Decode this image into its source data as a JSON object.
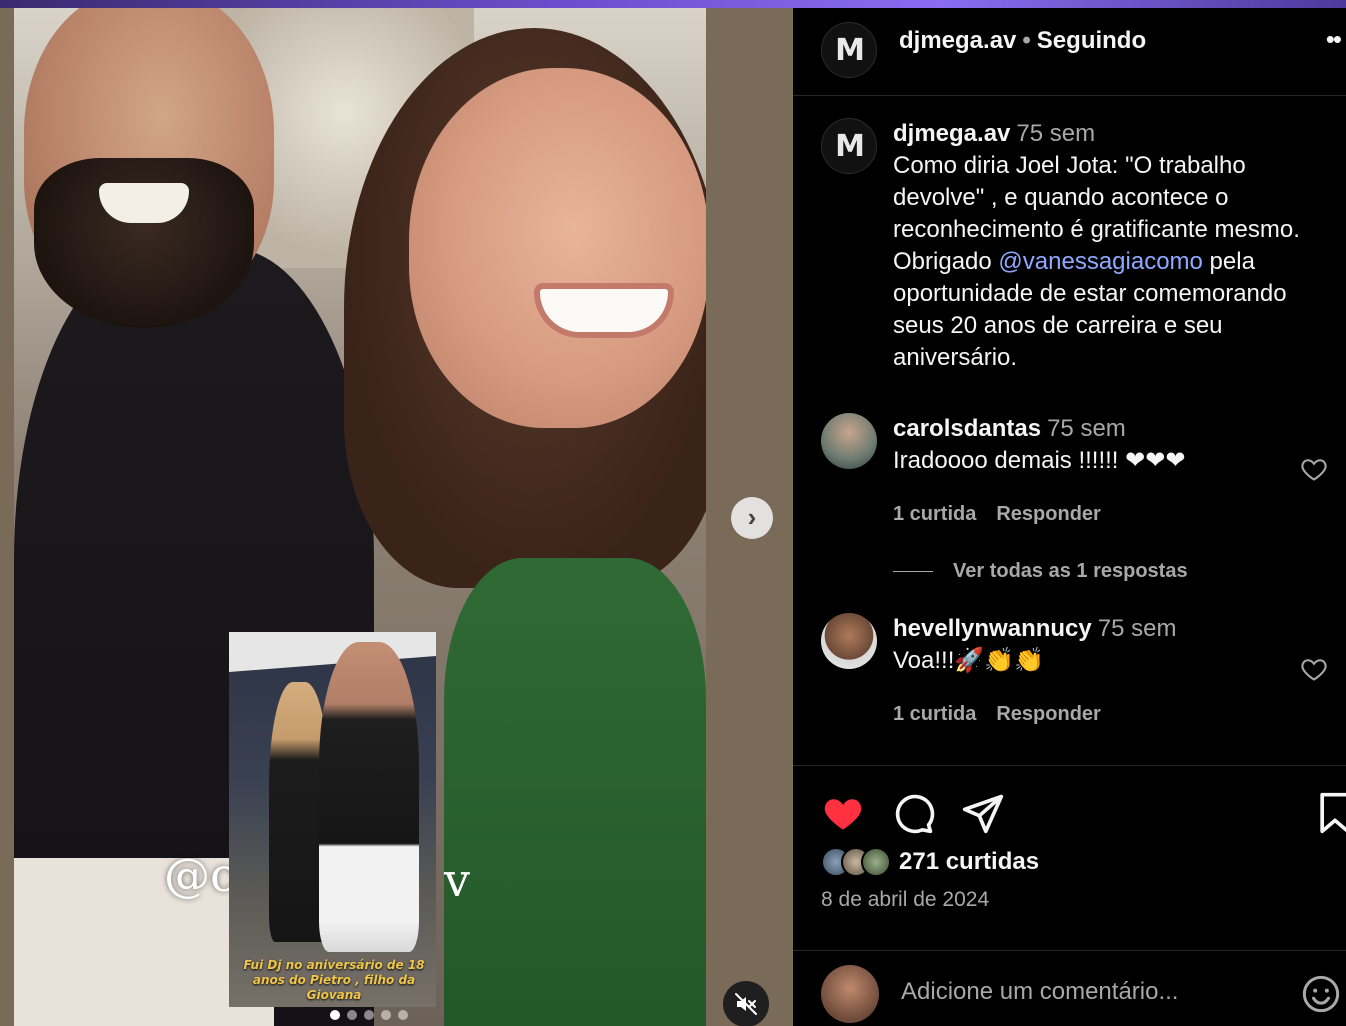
{
  "post": {
    "username": "djmega.av",
    "follow_state": "Seguindo",
    "more_label": "••",
    "logo_letter": "M",
    "caption": {
      "username": "djmega.av",
      "time": "75 sem",
      "text_before": "Como diria Joel Jota: \"O trabalho devolve\" , e quando acontece o reconhecimento é gratificante mesmo.  Obrigado ",
      "mention": "@vanessagiacomo",
      "text_after": " pela oportunidade de estar comemorando seus 20 anos de carreira e seu aniversário."
    }
  },
  "media": {
    "tag_text_left": "@c",
    "tag_text_right": "v",
    "inset_caption": "Fui Dj no aniversário de 18 anos do Pietro , filho da Giovana",
    "next_glyph": "›",
    "dots_count": 5,
    "active_dot": 0
  },
  "comments": [
    {
      "username": "carolsdantas",
      "time": "75 sem",
      "text": "Iradoooo demais !!!!!! ❤❤❤",
      "likes": "1 curtida",
      "reply_label": "Responder"
    },
    {
      "username": "hevellynwannucy",
      "time": "75 sem",
      "text": "Voa!!!🚀👏👏",
      "likes": "1 curtida",
      "reply_label": "Responder"
    }
  ],
  "view_replies": "Ver todas as 1 respostas",
  "actions": {
    "likes_count": "271 curtidas",
    "date": "8 de abril de 2024",
    "liked_color": "#ff3040"
  },
  "add_comment": {
    "placeholder": "Adicione um comentário..."
  }
}
